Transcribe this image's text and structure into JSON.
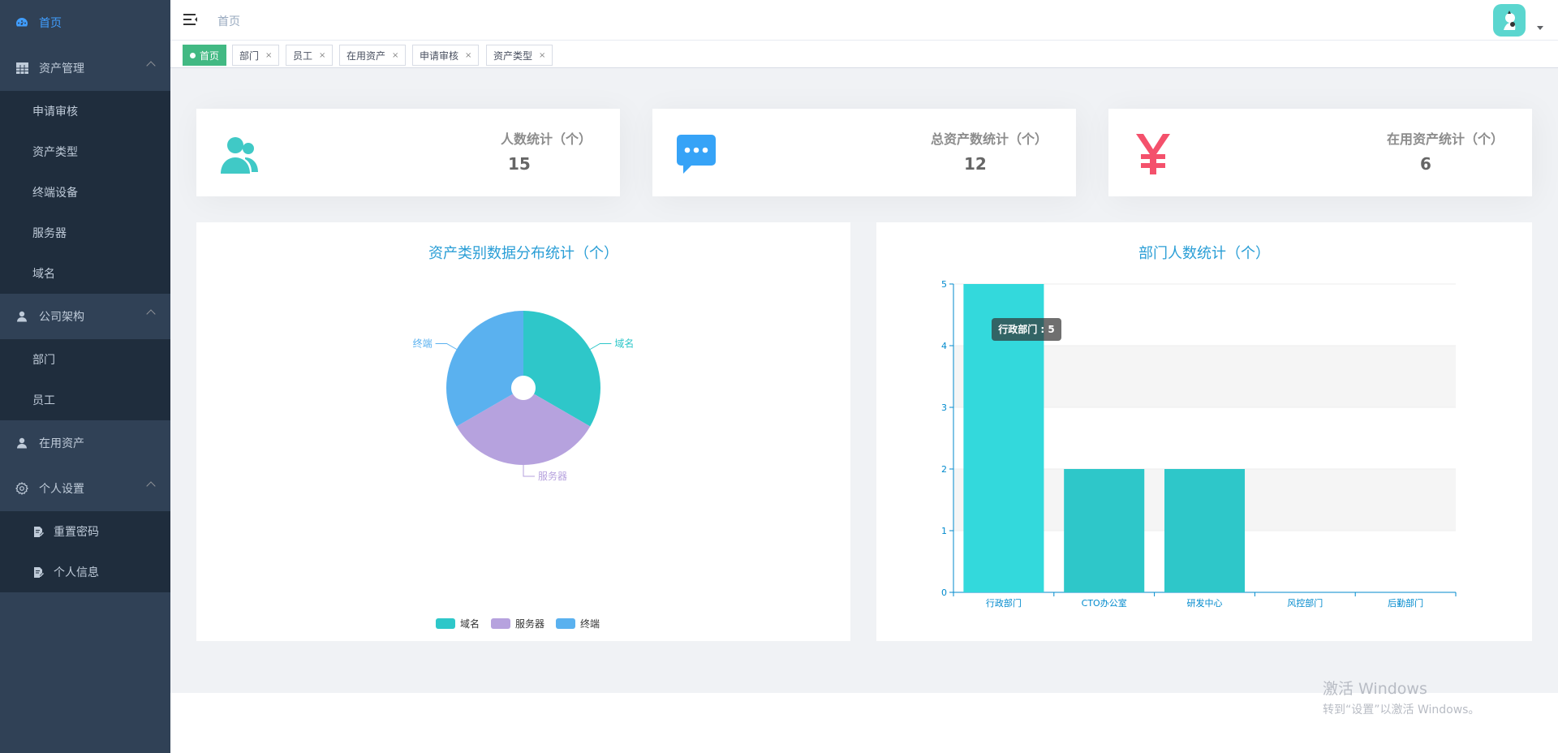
{
  "sidebar": {
    "home": "首页",
    "asset_mgmt": "资产管理",
    "asset_sub": [
      "申请审核",
      "资产类型",
      "终端设备",
      "服务器",
      "域名"
    ],
    "company": "公司架构",
    "company_sub": [
      "部门",
      "员工"
    ],
    "in_use": "在用资产",
    "personal": "个人设置",
    "personal_sub": [
      "重置密码",
      "个人信息"
    ],
    "bg_color": "#304156",
    "sub_bg_color": "#1f2d3d",
    "active_color": "#409eff"
  },
  "header": {
    "breadcrumb": "首页"
  },
  "tags": [
    {
      "label": "首页",
      "active": true
    },
    {
      "label": "部门",
      "active": false
    },
    {
      "label": "员工",
      "active": false
    },
    {
      "label": "在用资产",
      "active": false
    },
    {
      "label": "申请审核",
      "active": false
    },
    {
      "label": "资产类型",
      "active": false
    }
  ],
  "tag_close": "×",
  "tag_active_color": "#42b983",
  "stats": [
    {
      "label": "人数统计（个）",
      "value": "15",
      "icon": "users-icon",
      "color": "#40c9c6"
    },
    {
      "label": "总资产数统计（个）",
      "value": "12",
      "icon": "message-icon",
      "color": "#36a3f7"
    },
    {
      "label": "在用资产统计（个）",
      "value": "6",
      "icon": "yen-icon",
      "color": "#f4516c"
    }
  ],
  "pie_panel": {
    "title": "资产类别数据分布统计（个）"
  },
  "bar_panel": {
    "title": "部门人数统计（个）",
    "tooltip": "行政部门 : 5"
  },
  "chart_data": [
    {
      "type": "pie",
      "title": "资产类别数据分布统计（个）",
      "categories": [
        "域名",
        "服务器",
        "终端"
      ],
      "values": [
        4,
        4,
        4
      ],
      "colors": [
        "#2ec7c9",
        "#b6a2de",
        "#5ab1ef"
      ],
      "legend": "bottom"
    },
    {
      "type": "bar",
      "title": "部门人数统计（个）",
      "categories": [
        "行政部门",
        "CTO办公室",
        "研发中心",
        "风控部门",
        "后勤部门"
      ],
      "values": [
        5,
        2,
        2,
        0,
        0
      ],
      "ylim": [
        0,
        5
      ],
      "yticks": [
        "0",
        "1",
        "2",
        "3",
        "4",
        "5"
      ],
      "highlight_index": 0,
      "colors": {
        "bar": "#2ec7c9",
        "highlight": "#33d9dc",
        "axis": "#008acd"
      }
    }
  ],
  "watermark": {
    "line1": "激活 Windows",
    "line2": "转到“设置”以激活 Windows。"
  }
}
